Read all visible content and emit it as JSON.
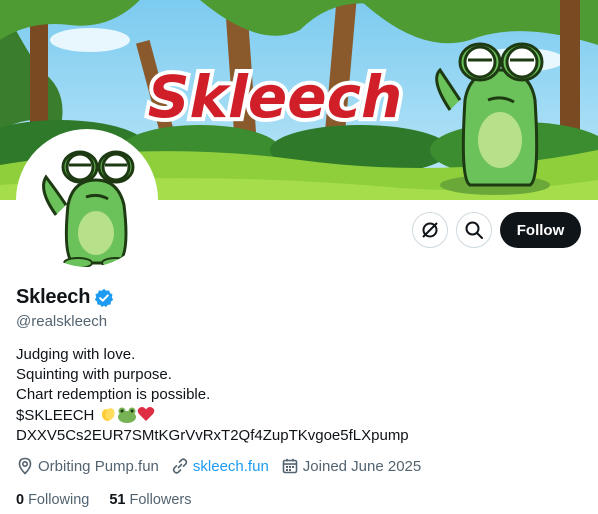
{
  "banner": {
    "title": "Skleech"
  },
  "profile": {
    "display_name": "Skleech",
    "handle": "@realskleech",
    "verified": true,
    "bio_lines": [
      "Judging with love.",
      "Squinting with purpose.",
      "Chart redemption is possible.",
      "$SKLEECH",
      "DXXV5Cs2EUR7SMtKGrVvRxT2Qf4ZupTKvgoe5fLXpump"
    ],
    "location": "Orbiting Pump.fun",
    "website": "skleech.fun",
    "joined": "Joined June 2025",
    "following_count": "0",
    "following_label": "Following",
    "followers_count": "51",
    "followers_label": "Followers"
  },
  "actions": {
    "follow_label": "Follow",
    "icons": [
      "grok-icon",
      "search-icon"
    ]
  },
  "colors": {
    "accent": "#1d9bf0",
    "follow_bg": "#0f1419",
    "secondary_text": "#536471",
    "border": "#cfd9de"
  }
}
